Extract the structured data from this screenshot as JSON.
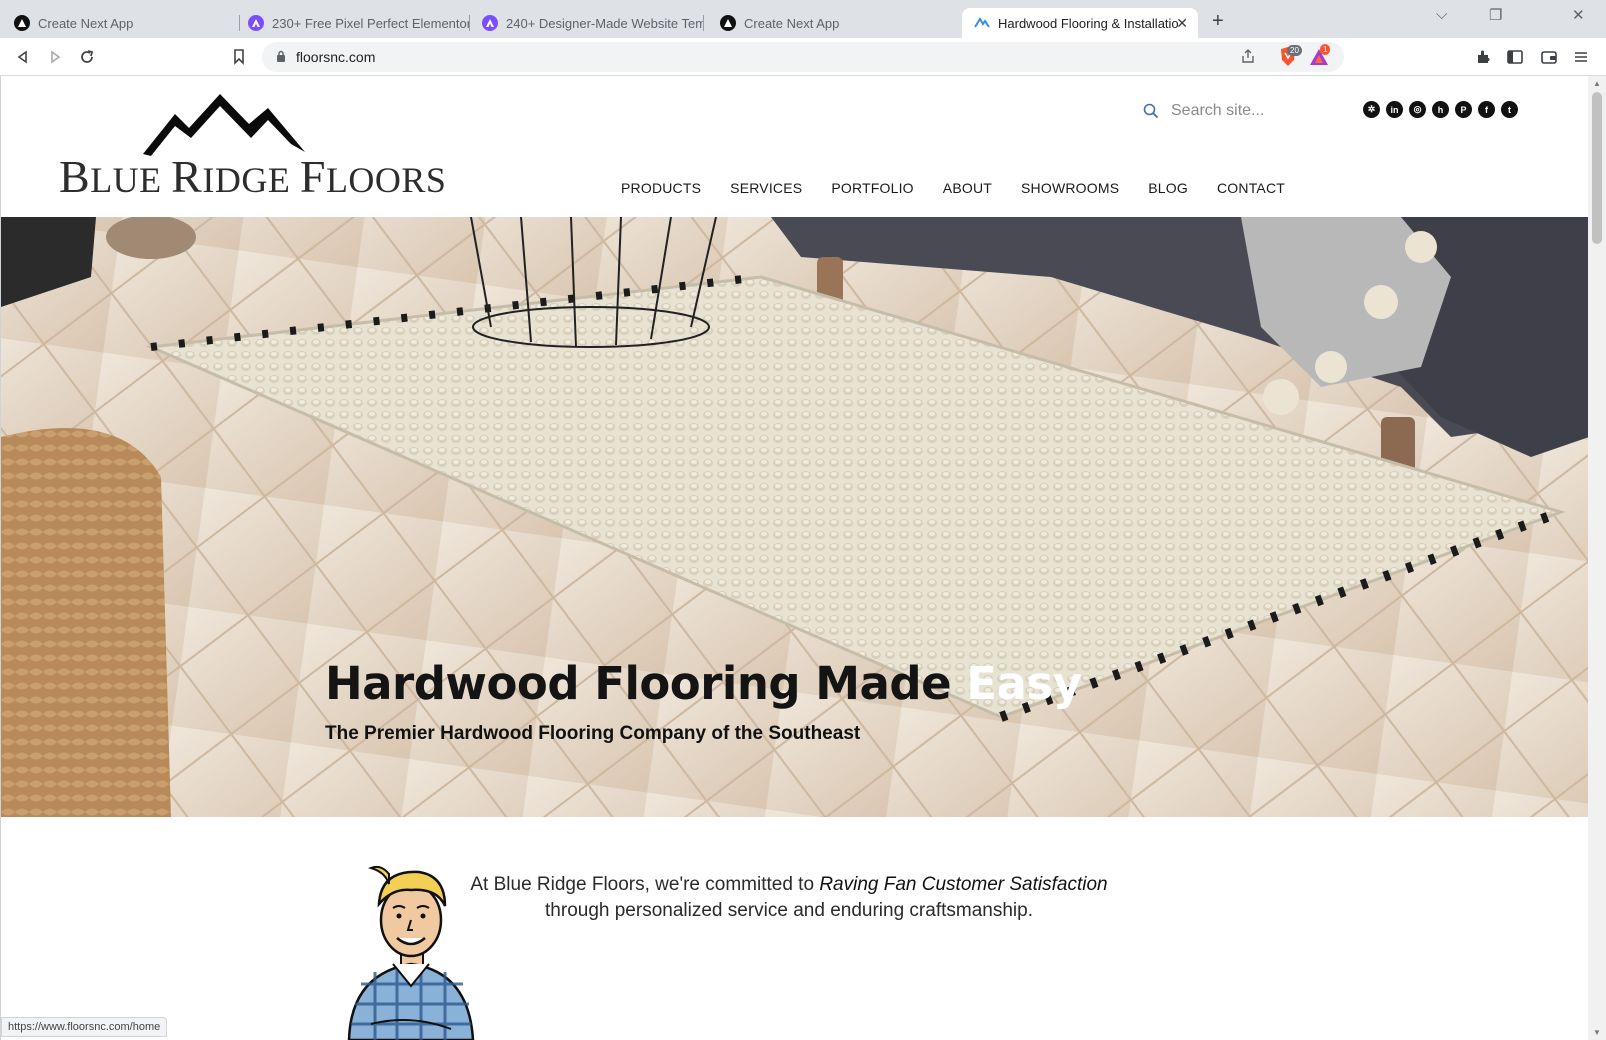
{
  "browser": {
    "tabs": [
      {
        "title": "Create Next App",
        "icon": "next-icon",
        "active": false
      },
      {
        "title": "230+ Free Pixel Perfect Elementor Tem",
        "icon": "astra-icon",
        "active": false
      },
      {
        "title": "240+ Designer-Made Website Templat",
        "icon": "astra-icon",
        "active": false
      },
      {
        "title": "Create Next App",
        "icon": "next-icon",
        "active": false
      },
      {
        "title": "Hardwood Flooring & Installation",
        "icon": "brf-icon",
        "active": true
      }
    ],
    "new_tab": "+",
    "window_controls": {
      "minimize": "⌵",
      "restore": "❐",
      "close": "✕"
    },
    "url": "floorsnc.com",
    "brave_shield_count": "20",
    "rewards_count": "1",
    "status_url": "https://www.floorsnc.com/home"
  },
  "site": {
    "logo": {
      "word1_first": "B",
      "word1_rest": "LUE ",
      "word2_first": "R",
      "word2_rest": "IDGE ",
      "word3_first": "F",
      "word3_rest": "LOORS"
    },
    "search_placeholder": "Search site...",
    "social": [
      {
        "name": "yelp",
        "glyph": "✲"
      },
      {
        "name": "linkedin",
        "glyph": "in"
      },
      {
        "name": "instagram",
        "glyph": "◎"
      },
      {
        "name": "houzz",
        "glyph": "h"
      },
      {
        "name": "pinterest",
        "glyph": "P"
      },
      {
        "name": "facebook",
        "glyph": "f"
      },
      {
        "name": "twitter",
        "glyph": "t"
      }
    ],
    "nav": [
      "PRODUCTS",
      "SERVICES",
      "PORTFOLIO",
      "ABOUT",
      "SHOWROOMS",
      "BLOG",
      "CONTACT"
    ],
    "hero": {
      "title_dark": "Hardwood Flooring Made ",
      "title_light": "Easy",
      "subtitle": "The Premier Hardwood Flooring Company of the Southeast"
    },
    "intro": {
      "lead": "At Blue Ridge Floors, we're committed to ",
      "emphasis": "Raving Fan Customer Satisfaction",
      "line2": "through personalized service and enduring craftsmanship."
    }
  },
  "colors": {
    "accent_search": "#3b6fb6",
    "brave": "#fb542b",
    "rewards": "#a63cc9"
  }
}
